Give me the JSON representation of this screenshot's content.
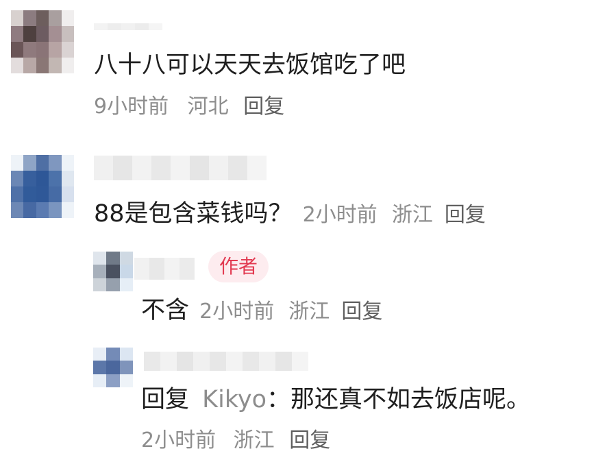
{
  "comments": [
    {
      "text": "八十八可以天天去饭馆吃了吧",
      "time": "9小时前",
      "location": "河北",
      "reply_label": "回复",
      "avatar_colors": [
        "#d8d1cf",
        "#8c7c80",
        "#6d5e5d",
        "#a99f9f",
        "#f0eeee",
        "#8f7b80",
        "#4e403f",
        "#6d5c61",
        "#a48f93",
        "#c8bfbe",
        "#6a5557",
        "#8f7a7d",
        "#8a7477",
        "#b7a4a4",
        "#dad3d3",
        "#e3dddd",
        "#b8a8a6",
        "#8a7775",
        "#c2b7b3",
        "#f0eeee"
      ]
    },
    {
      "text": "88是包含菜钱吗？",
      "time": "2小时前",
      "location": "浙江",
      "reply_label": "回复",
      "avatar_colors": [
        "#eef3f8",
        "#8fa5c6",
        "#4f6fa4",
        "#7f97bf",
        "#eef3f8",
        "#6b87b5",
        "#375f9d",
        "#2e5797",
        "#4c72aa",
        "#dfe7f0",
        "#4f71a8",
        "#315b9a",
        "#2f5898",
        "#466ba5",
        "#d7e0ee",
        "#6d88b5",
        "#4769a3",
        "#5b7bb1",
        "#7a95bf",
        "#eef3f8"
      ]
    }
  ],
  "replies": [
    {
      "badge": "作者",
      "text": "不含",
      "time": "2小时前",
      "location": "浙江",
      "reply_label": "回复",
      "avatar_colors": [
        "#dfe5ec",
        "#707a88",
        "#cfd9e3",
        "#a7b0bb",
        "#4a5160",
        "#c9d8e8",
        "#cdd3d9",
        "#96a0ad",
        "#e6eef6"
      ]
    },
    {
      "prefix": "回复",
      "reply_to": "Kikyo",
      "colon_text": "：那还真不如去饭店呢。",
      "time": "2小时前",
      "location": "浙江",
      "reply_label": "回复",
      "avatar_colors": [
        "#e8eef6",
        "#748bb7",
        "#dce6f2",
        "#5c77a9",
        "#4b679d",
        "#7f94bb",
        "#e7eef6",
        "#8c9fc4",
        "#eef3f8"
      ]
    }
  ]
}
